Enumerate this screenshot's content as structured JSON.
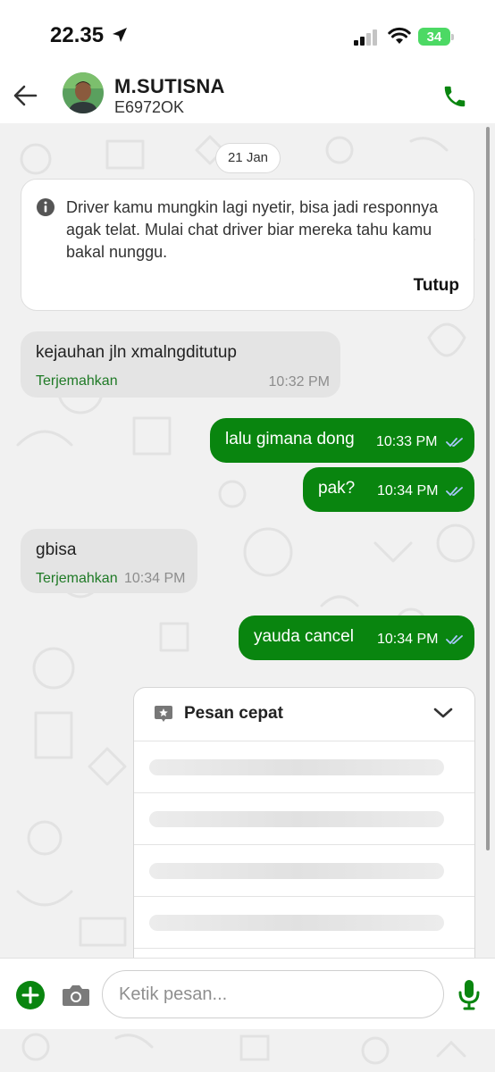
{
  "status_bar": {
    "time": "22.35",
    "battery": "34"
  },
  "header": {
    "name": "M.SUTISNA",
    "plate": "E6972OK"
  },
  "chat": {
    "date_chip": "21 Jan",
    "notice": {
      "text": "Driver kamu mungkin lagi nyetir, bisa jadi responnya agak telat. Mulai chat driver biar mereka tahu kamu bakal nunggu.",
      "close_label": "Tutup"
    },
    "messages": [
      {
        "direction": "in",
        "text": "kejauhan jln  xmalngditutup",
        "translate": "Terjemahkan",
        "time": "10:32 PM"
      },
      {
        "direction": "out",
        "text": "lalu gimana dong",
        "time": "10:33 PM"
      },
      {
        "direction": "out",
        "text": "pak?",
        "time": "10:34 PM"
      },
      {
        "direction": "in",
        "text": "gbisa",
        "translate": "Terjemahkan",
        "time": "10:34 PM"
      },
      {
        "direction": "out",
        "text": "yauda cancel",
        "time": "10:34 PM"
      }
    ]
  },
  "quick_reply": {
    "title": "Pesan cepat",
    "icon": "star-chat-icon",
    "state": "loading"
  },
  "input": {
    "placeholder": "Ketik pesan..."
  },
  "colors": {
    "brand_green": "#09850f",
    "incoming_bubble": "#e4e4e4",
    "chat_background": "#f1f1f1"
  }
}
